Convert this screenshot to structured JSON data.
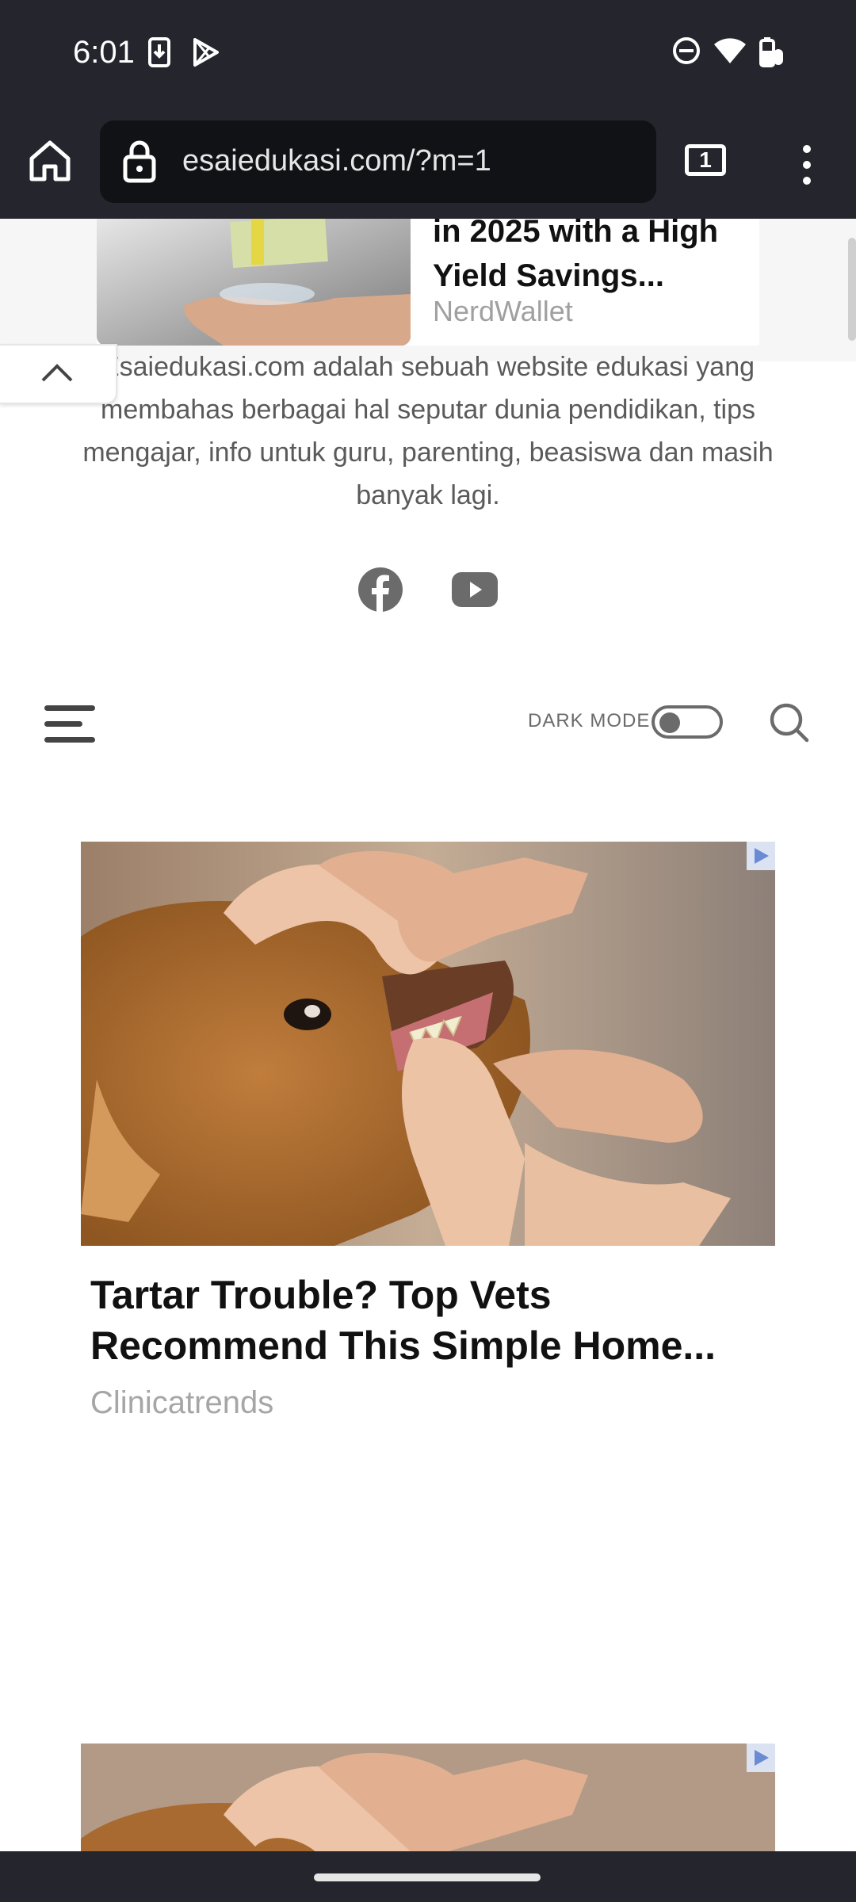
{
  "status_bar": {
    "time": "6:01",
    "icons": [
      "download-icon",
      "play-store-icon",
      "do-not-disturb-icon",
      "wifi-icon",
      "battery-icon"
    ]
  },
  "browser": {
    "url": "esaiedukasi.com/?m=1",
    "tab_count": "1",
    "icons": [
      "home-icon",
      "lock-icon",
      "tabs-icon",
      "more-vert-icon"
    ]
  },
  "ad_top": {
    "title": "in 2025 with a High Yield Savings...",
    "source": "NerdWallet"
  },
  "site": {
    "description": "Esaiedukasi.com adalah sebuah website edukasi yang membahas berbagai hal seputar dunia pendidikan, tips mengajar, info untuk guru, parenting, beasiswa dan masih banyak lagi.",
    "social_icons": [
      "facebook-icon",
      "youtube-icon"
    ],
    "dark_mode_label": "DARK MODE"
  },
  "ad_main": {
    "title": "Tartar Trouble? Top Vets Recommend This Simple Home...",
    "source": "Clinicatrends"
  },
  "colors": {
    "chrome": "#24252d",
    "url_box": "#111216",
    "text_muted": "#a6a6a6",
    "icon_gray": "#6b6b6b"
  }
}
